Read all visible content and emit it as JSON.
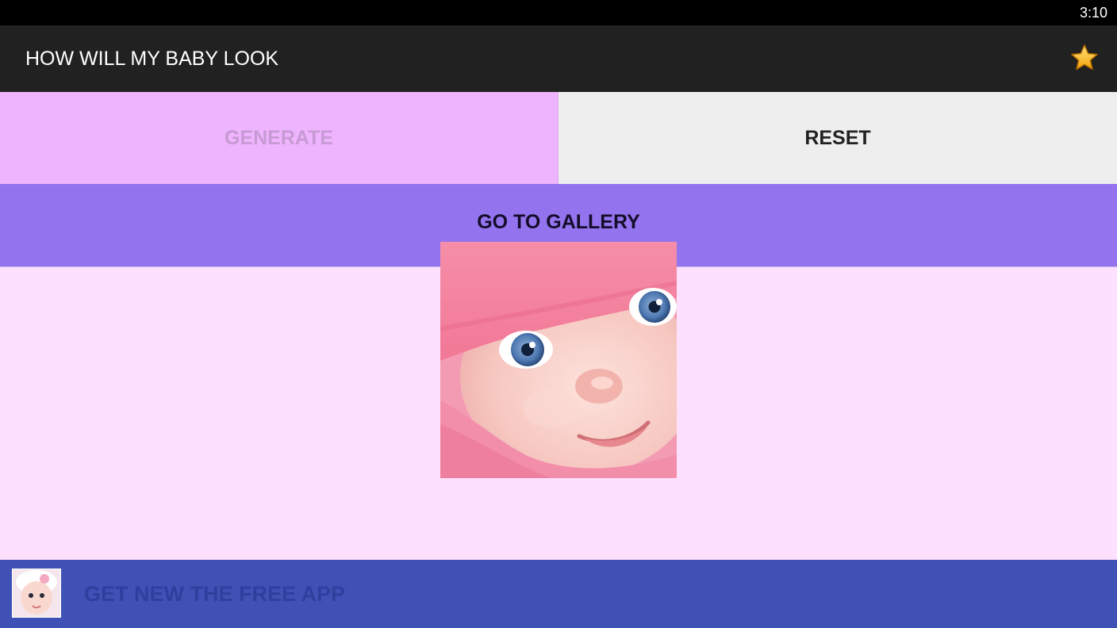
{
  "status_bar": {
    "time": "3:10"
  },
  "app_bar": {
    "title": "HOW WILL MY BABY LOOK",
    "rate_icon": "star-icon"
  },
  "buttons": {
    "generate_label": "GENERATE",
    "reset_label": "RESET",
    "gallery_label": "GO TO GALLERY"
  },
  "main": {
    "photo_icon": "baby-photo"
  },
  "ad_banner": {
    "text": "GET NEW THE FREE APP",
    "thumb_icon": "baby-app-icon"
  },
  "colors": {
    "status_bar": "#000000",
    "app_bar": "#212121",
    "generate_bg": "#efb4fe",
    "generate_text": "#c79ad4",
    "reset_bg": "#eeeeee",
    "gallery_bg": "#9473ee",
    "content_bg": "#fde0fd",
    "ad_bg": "#3f51b5",
    "ad_text": "#2f3f9e"
  }
}
